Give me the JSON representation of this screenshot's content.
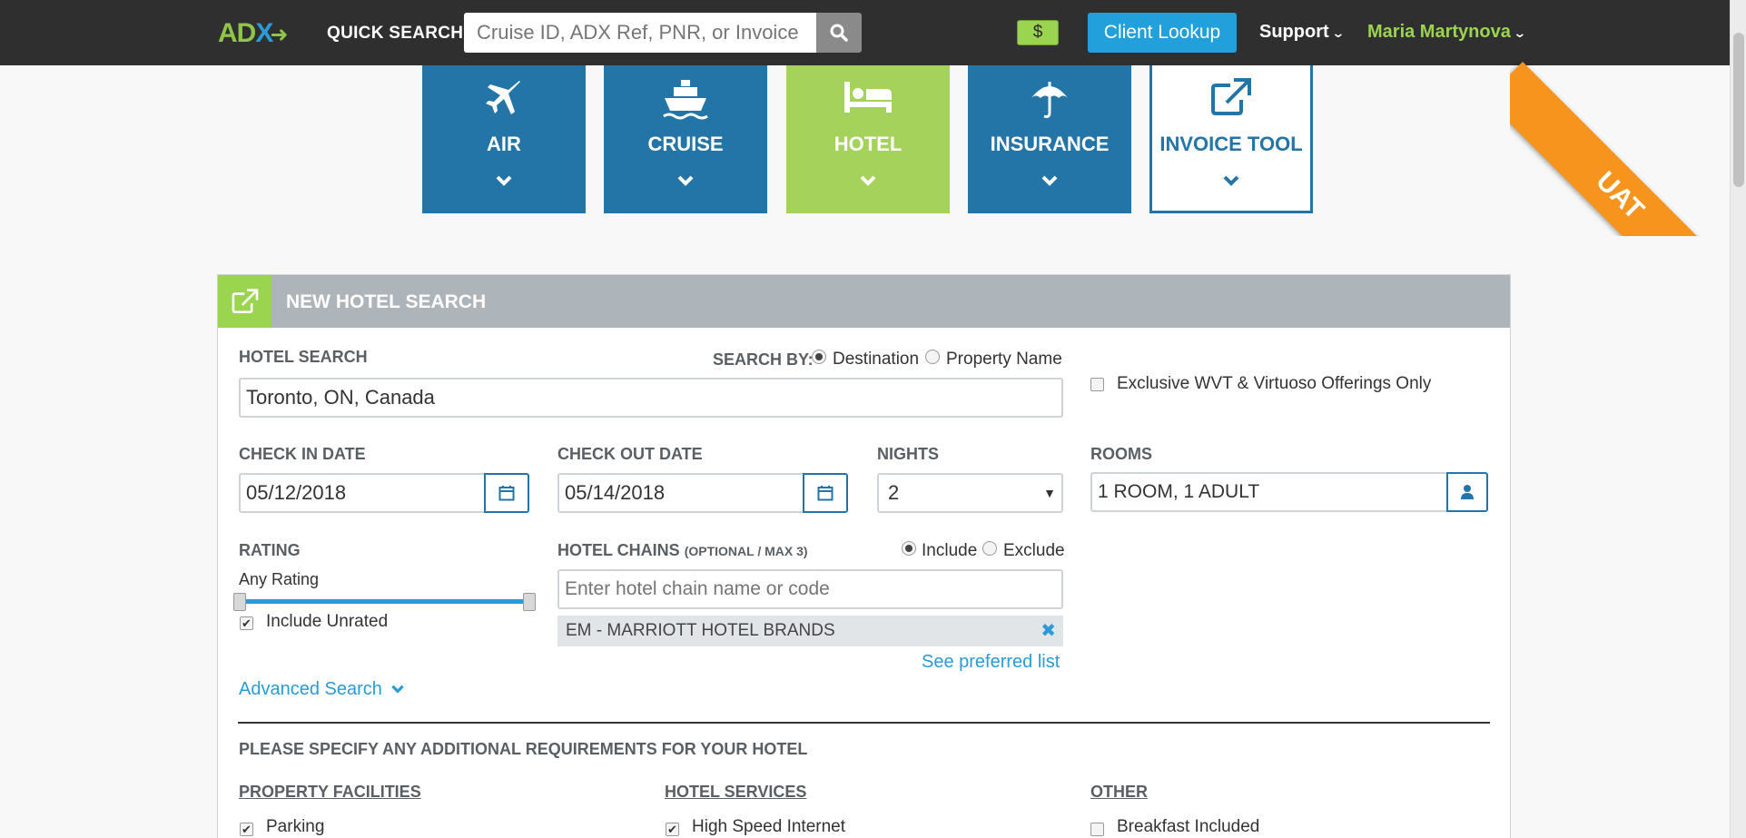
{
  "header": {
    "logo": "ADX",
    "quick_search_label": "QUICK SEARCH",
    "quick_search_placeholder": "Cruise ID, ADX Ref, PNR, or Invoice #.",
    "currency_badge": "$",
    "client_lookup": "Client Lookup",
    "support": "Support",
    "user": "Maria Martynova",
    "env_ribbon": "UAT"
  },
  "products": [
    {
      "label": "AIR",
      "icon": "plane-icon"
    },
    {
      "label": "CRUISE",
      "icon": "ship-icon"
    },
    {
      "label": "HOTEL",
      "icon": "bed-icon"
    },
    {
      "label": "INSURANCE",
      "icon": "umbrella-icon"
    },
    {
      "label": "INVOICE TOOL",
      "icon": "external-link-icon"
    }
  ],
  "panel": {
    "title": "NEW HOTEL SEARCH",
    "hotel_search_label": "HOTEL SEARCH",
    "search_by_label": "SEARCH BY:",
    "search_by_options": [
      "Destination",
      "Property Name"
    ],
    "search_by_selected": "Destination",
    "hotel_search_value": "Toronto, ON, Canada",
    "exclusive_label": "Exclusive WVT & Virtuoso Offerings Only",
    "check_in_label": "CHECK IN DATE",
    "check_in_value": "05/12/2018",
    "check_out_label": "CHECK OUT DATE",
    "check_out_value": "05/14/2018",
    "nights_label": "NIGHTS",
    "nights_value": "2",
    "rooms_label": "ROOMS",
    "rooms_value": "1 ROOM, 1 ADULT",
    "rating_label": "RATING",
    "rating_value": "Any Rating",
    "include_unrated": "Include Unrated",
    "chains_label": "HOTEL CHAINS",
    "chains_note": "(OPTIONAL / MAX 3)",
    "chains_include": "Include",
    "chains_exclude": "Exclude",
    "chains_placeholder": "Enter hotel chain name or code",
    "chain_selected": "EM - MARRIOTT HOTEL BRANDS",
    "preferred_link": "See preferred list",
    "advanced_search": "Advanced Search",
    "requirements_heading": "PLEASE SPECIFY ANY ADDITIONAL REQUIREMENTS FOR YOUR HOTEL",
    "facilities_heading": "PROPERTY FACILITIES",
    "services_heading": "HOTEL SERVICES",
    "other_heading": "OTHER",
    "facility_item": "Parking",
    "service_item": "High Speed Internet",
    "other_item": "Breakfast Included"
  },
  "colors": {
    "primary": "#2475a7",
    "accent_green": "#a5d25a",
    "link": "#2a9bd6",
    "ribbon": "#f7941d"
  }
}
